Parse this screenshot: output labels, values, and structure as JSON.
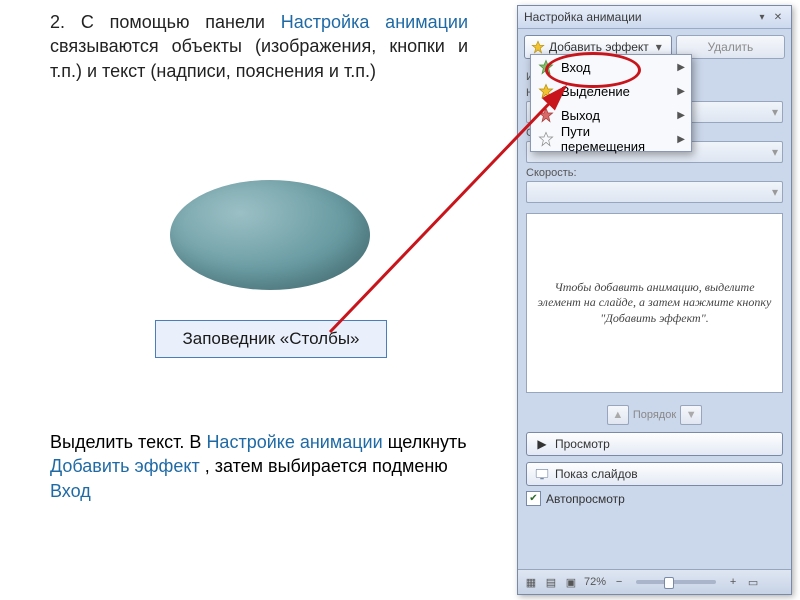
{
  "content": {
    "p1_a": "2. С помощью панели ",
    "p1_hl": "Настройка анимации",
    "p1_b": " связываются объекты (изображения, кнопки и т.п.) и текст (надписи, пояснения и т.п.)",
    "sample_label": "Заповедник «Столбы»",
    "p2_a": "Выделить текст. В ",
    "p2_h1": "Настройке анимации",
    "p2_b": " щелкнуть ",
    "p2_h2": "Добавить эффект",
    "p2_c": ", затем выбирается подменю  ",
    "p2_h3": "Вход"
  },
  "pane": {
    "title": "Настройка анимации",
    "add_effect": "Добавить эффект",
    "remove": "Удалить",
    "props": {
      "change": "Изменение",
      "start": "Начало:",
      "property": "Свойство:",
      "speed": "Скорость:"
    },
    "placeholder": "Чтобы добавить анимацию, выделите элемент на слайде, а затем нажмите кнопку \"Добавить эффект\".",
    "order": "Порядок",
    "preview": "Просмотр",
    "slideshow": "Показ слайдов",
    "autopreview": "Автопросмотр"
  },
  "menu": {
    "entrance": "Вход",
    "emphasis": "Выделение",
    "exit": "Выход",
    "motion": "Пути перемещения"
  },
  "status": {
    "zoom": "72%"
  }
}
